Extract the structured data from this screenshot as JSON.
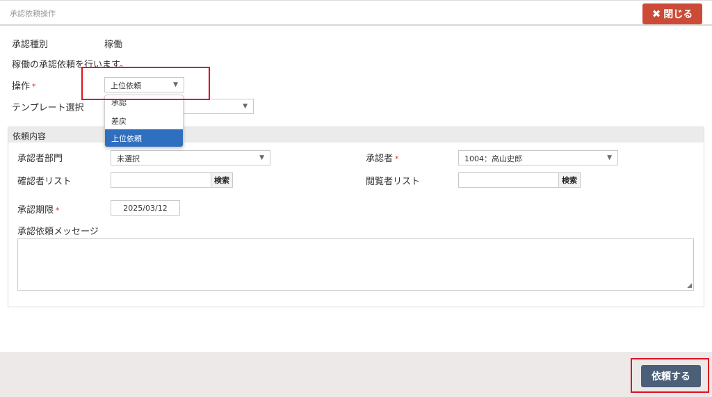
{
  "dialog": {
    "title": "承認依頼操作",
    "close_label": "閉じる"
  },
  "form": {
    "type_label": "承認種別",
    "type_value": "稼働",
    "description": "稼働の承認依頼を行います。",
    "operation_label": "操作",
    "operation_value": "上位依頼",
    "operation_options": [
      "承認",
      "差戻",
      "上位依頼"
    ],
    "template_label": "テンプレート選択",
    "template_value": ""
  },
  "request": {
    "section_title": "依頼内容",
    "approver_dept_label": "承認者部門",
    "approver_dept_value": "未選択",
    "approver_label": "承認者",
    "approver_value": "1004：高山史郎",
    "confirmer_label": "確認者リスト",
    "confirmer_value": "",
    "viewer_label": "閲覧者リスト",
    "viewer_value": "",
    "search_label": "検索",
    "deadline_label": "承認期限",
    "deadline_value": "2025/03/12",
    "message_label": "承認依頼メッセージ",
    "message_value": ""
  },
  "footer": {
    "submit_label": "依頼する"
  },
  "colors": {
    "close": "#cc4b37",
    "submit": "#4b5f79",
    "selected": "#2f6fc0",
    "highlight": "#e01020",
    "required": "#d9332b"
  },
  "icons": {
    "close": "x-icon",
    "select": "chevron-down-icon",
    "resize": "resize-handle-icon"
  }
}
